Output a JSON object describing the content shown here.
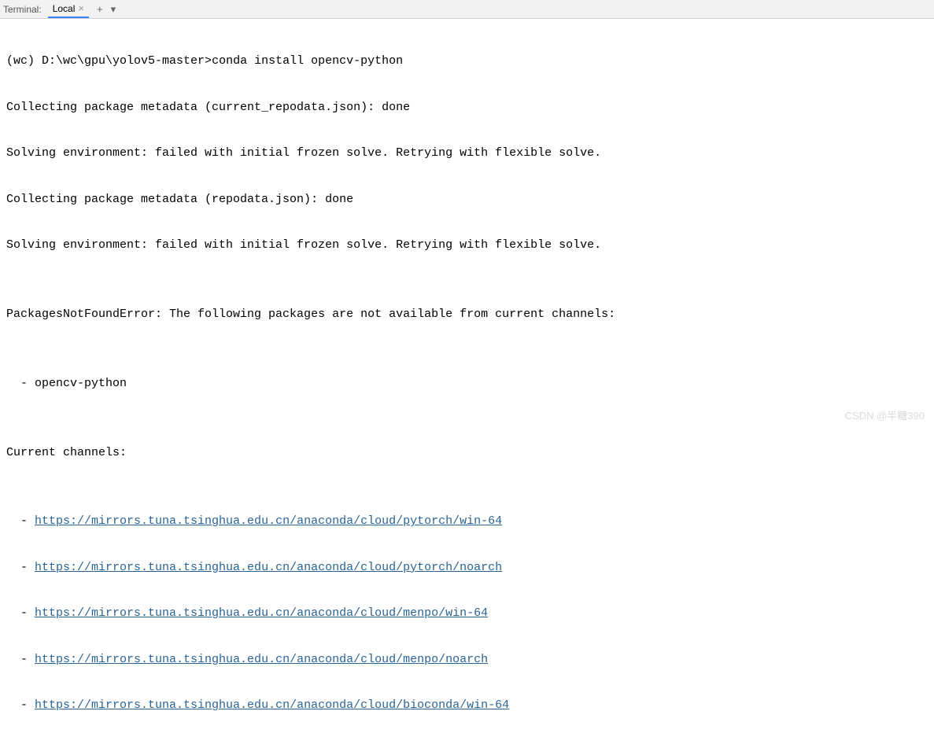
{
  "toolbar": {
    "label": "Terminal:",
    "tab_name": "Local",
    "add_label": "+",
    "dropdown_glyph": "▾"
  },
  "prompt": {
    "env": "(wc) ",
    "path": "D:\\wc\\gpu\\yolov5-master>",
    "command": "conda install opencv-python"
  },
  "output_lines": [
    "Collecting package metadata (current_repodata.json): done",
    "Solving environment: failed with initial frozen solve. Retrying with flexible solve.",
    "Collecting package metadata (repodata.json): done",
    "Solving environment: failed with initial frozen solve. Retrying with flexible solve.",
    "",
    "PackagesNotFoundError: The following packages are not available from current channels:",
    "",
    "  - opencv-python",
    "",
    "Current channels:",
    ""
  ],
  "channel_prefix": "  - ",
  "channels": [
    "https://mirrors.tuna.tsinghua.edu.cn/anaconda/cloud/pytorch/win-64",
    "https://mirrors.tuna.tsinghua.edu.cn/anaconda/cloud/pytorch/noarch",
    "https://mirrors.tuna.tsinghua.edu.cn/anaconda/cloud/menpo/win-64",
    "https://mirrors.tuna.tsinghua.edu.cn/anaconda/cloud/menpo/noarch",
    "https://mirrors.tuna.tsinghua.edu.cn/anaconda/cloud/bioconda/win-64"
  ],
  "watermark": "CSDN @半糖390"
}
